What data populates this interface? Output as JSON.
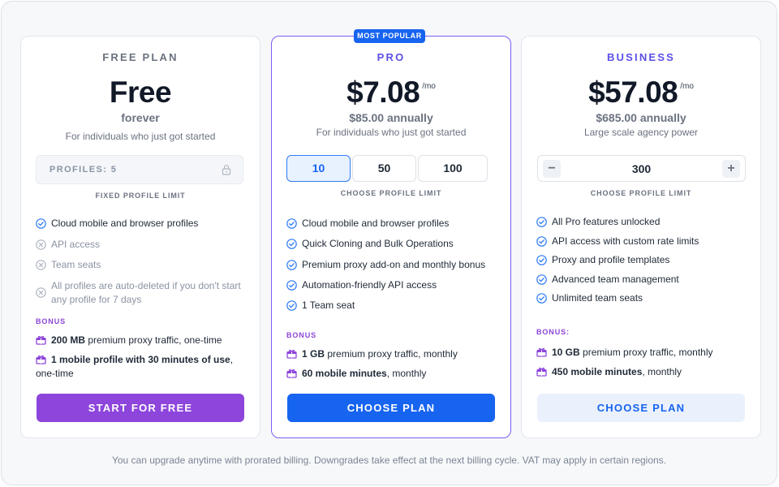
{
  "free": {
    "plan_name": "FREE PLAN",
    "price": "Free",
    "sub_price": "forever",
    "tagline": "For individuals who just got started",
    "profiles_label": "PROFILES: 5",
    "limit_caption": "FIXED PROFILE LIMIT",
    "features": [
      {
        "text": "Cloud mobile and browser profiles",
        "included": true
      },
      {
        "text": "API access",
        "included": false
      },
      {
        "text": "Team seats",
        "included": false
      },
      {
        "text": "All profiles are auto-deleted if you don't start any profile for 7 days",
        "included": false
      }
    ],
    "bonus_title": "BONUS",
    "bonus": [
      {
        "bold": "200 MB",
        "rest": " premium proxy traffic, one-time"
      },
      {
        "bold": "1 mobile profile with 30 minutes of use",
        "rest": ", one-time"
      }
    ],
    "cta": "START FOR FREE"
  },
  "pro": {
    "badge": "MOST POPULAR",
    "plan_name": "PRO",
    "price": "$7.08",
    "unit": "/mo",
    "sub_price": "$85.00 annually",
    "tagline": "For individuals who just got started",
    "options": [
      "10",
      "50",
      "100"
    ],
    "selected_option": "10",
    "limit_caption": "CHOOSE PROFILE LIMIT",
    "features": [
      "Cloud mobile and browser profiles",
      "Quick Cloning and Bulk Operations",
      "Premium proxy add-on and monthly bonus",
      "Automation-friendly API access",
      "1 Team seat"
    ],
    "bonus_title": "BONUS",
    "bonus": [
      {
        "bold": "1 GB",
        "rest": " premium proxy traffic, monthly"
      },
      {
        "bold": "60 mobile minutes",
        "rest": ", monthly"
      }
    ],
    "cta": "CHOOSE PLAN"
  },
  "business": {
    "plan_name": "BUSINESS",
    "price": "$57.08",
    "unit": "/mo",
    "sub_price": "$685.00 annually",
    "tagline": "Large scale agency power",
    "stepper_value": "300",
    "minus": "−",
    "plus": "+",
    "limit_caption": "CHOOSE PROFILE LIMIT",
    "features": [
      "All Pro features unlocked",
      "API access with custom rate limits",
      "Proxy and profile templates",
      "Advanced team management",
      "Unlimited team seats"
    ],
    "bonus_title": "BONUS:",
    "bonus": [
      {
        "bold": "10 GB",
        "rest": " premium proxy traffic, monthly"
      },
      {
        "bold": "450 mobile minutes",
        "rest": ", monthly"
      }
    ],
    "cta": "CHOOSE PLAN"
  },
  "footer_note": "You can upgrade anytime with prorated billing. Downgrades take effect at the next billing cycle. VAT may apply in certain regions.",
  "colors": {
    "accent_blue": "#1764f0",
    "accent_purple": "#8d45db",
    "check_blue": "#2f7cf6",
    "muted": "#8a93a3"
  }
}
